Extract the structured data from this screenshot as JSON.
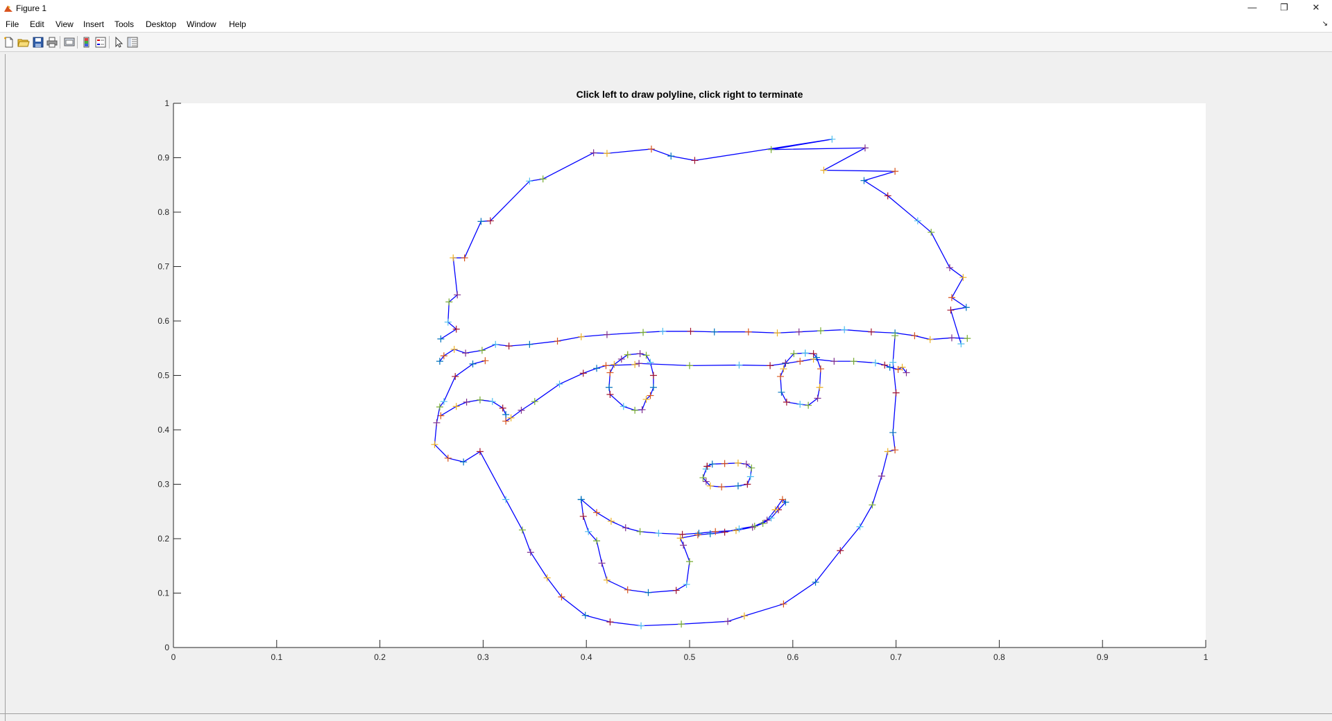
{
  "window": {
    "title": "Figure 1",
    "controls": {
      "minimize": "—",
      "maximize": "❐",
      "close": "✕"
    }
  },
  "menu": {
    "items": [
      {
        "label": "File"
      },
      {
        "label": "Edit"
      },
      {
        "label": "View"
      },
      {
        "label": "Insert"
      },
      {
        "label": "Tools"
      },
      {
        "label": "Desktop"
      },
      {
        "label": "Window"
      },
      {
        "label": "Help"
      }
    ],
    "dock_arrow": "↘"
  },
  "toolbar": {
    "buttons": [
      "new-figure-icon",
      "open-file-icon",
      "save-icon",
      "print-icon",
      "print-preview-icon",
      "colorbar-icon",
      "legend-icon",
      "pointer-icon",
      "property-editor-icon"
    ]
  },
  "colors": {
    "line": "#0000ff",
    "markers": [
      "#0072bd",
      "#d95319",
      "#edb120",
      "#7e2f8e",
      "#77ac30",
      "#4dbeee",
      "#a2142f"
    ],
    "axes_bg": "#ffffff",
    "figure_bg": "#f0f0f0"
  },
  "chart_data": {
    "type": "line",
    "title": "Click left to draw polyline, click right to terminate",
    "xlabel": "",
    "ylabel": "",
    "xlim": [
      0,
      1
    ],
    "ylim": [
      0,
      1
    ],
    "xticks": [
      0,
      0.1,
      0.2,
      0.3,
      0.4,
      0.5,
      0.6,
      0.7,
      0.8,
      0.9,
      1
    ],
    "yticks": [
      0,
      0.1,
      0.2,
      0.3,
      0.4,
      0.5,
      0.6,
      0.7,
      0.8,
      0.9,
      1
    ],
    "xtick_labels": [
      "0",
      "0.1",
      "0.2",
      "0.3",
      "0.4",
      "0.5",
      "0.6",
      "0.7",
      "0.8",
      "0.9",
      "1"
    ],
    "ytick_labels": [
      "0",
      "0.1",
      "0.2",
      "0.3",
      "0.4",
      "0.5",
      "0.6",
      "0.7",
      "0.8",
      "0.9",
      "1"
    ],
    "grid": false,
    "marker": "+",
    "series": [
      {
        "x": [
          0.258,
          0.262,
          0.272,
          0.283,
          0.299,
          0.312,
          0.325,
          0.345,
          0.372,
          0.395,
          0.42,
          0.455,
          0.474,
          0.501,
          0.524,
          0.557,
          0.585,
          0.606,
          0.627,
          0.65,
          0.676,
          0.699,
          0.718,
          0.733,
          0.754,
          0.769
        ],
        "y": [
          0.526,
          0.536,
          0.548,
          0.541,
          0.546,
          0.557,
          0.554,
          0.557,
          0.563,
          0.571,
          0.575,
          0.579,
          0.581,
          0.581,
          0.58,
          0.58,
          0.578,
          0.58,
          0.582,
          0.584,
          0.58,
          0.578,
          0.573,
          0.566,
          0.569,
          0.568
        ]
      },
      {
        "x": [
          0.763,
          0.753,
          0.768,
          0.754,
          0.765,
          0.752,
          0.734,
          0.721,
          0.692,
          0.669,
          0.699,
          0.63,
          0.67,
          0.579,
          0.638,
          0.505,
          0.482,
          0.463,
          0.42,
          0.407,
          0.358,
          0.345,
          0.307,
          0.298,
          0.282,
          0.271,
          0.275,
          0.267,
          0.266,
          0.274,
          0.259
        ],
        "y": [
          0.558,
          0.62,
          0.625,
          0.643,
          0.68,
          0.698,
          0.763,
          0.784,
          0.83,
          0.858,
          0.875,
          0.877,
          0.918,
          0.915,
          0.934,
          0.895,
          0.903,
          0.916,
          0.908,
          0.909,
          0.861,
          0.857,
          0.784,
          0.783,
          0.716,
          0.716,
          0.648,
          0.635,
          0.598,
          0.585,
          0.567
        ]
      },
      {
        "x": [
          0.259,
          0.274,
          0.284,
          0.297,
          0.309,
          0.319,
          0.322,
          0.322,
          0.327,
          0.337,
          0.35,
          0.374,
          0.397,
          0.41,
          0.419,
          0.447,
          0.451,
          0.5,
          0.548,
          0.578,
          0.593,
          0.607,
          0.62,
          0.64,
          0.659,
          0.68,
          0.689,
          0.694,
          0.702,
          0.706,
          0.71
        ],
        "y": [
          0.426,
          0.443,
          0.451,
          0.455,
          0.452,
          0.44,
          0.428,
          0.416,
          0.422,
          0.436,
          0.452,
          0.484,
          0.504,
          0.513,
          0.518,
          0.52,
          0.522,
          0.518,
          0.519,
          0.518,
          0.522,
          0.526,
          0.53,
          0.526,
          0.526,
          0.523,
          0.519,
          0.515,
          0.511,
          0.515,
          0.505
        ]
      },
      {
        "x": [
          0.699,
          0.697,
          0.7,
          0.697,
          0.699,
          0.692,
          0.686,
          0.677,
          0.665,
          0.646,
          0.622,
          0.591,
          0.553,
          0.537,
          0.492,
          0.453,
          0.423,
          0.399,
          0.376,
          0.362,
          0.346,
          0.338,
          0.322,
          0.297,
          0.281,
          0.266,
          0.253,
          0.255,
          0.258,
          0.262,
          0.273,
          0.29,
          0.302
        ],
        "y": [
          0.573,
          0.524,
          0.468,
          0.395,
          0.363,
          0.36,
          0.315,
          0.262,
          0.222,
          0.178,
          0.12,
          0.08,
          0.058,
          0.048,
          0.043,
          0.04,
          0.047,
          0.059,
          0.093,
          0.128,
          0.175,
          0.216,
          0.272,
          0.36,
          0.341,
          0.348,
          0.373,
          0.413,
          0.442,
          0.452,
          0.498,
          0.521,
          0.527
        ]
      },
      {
        "x": [
          0.44,
          0.452,
          0.458,
          0.462,
          0.465,
          0.465,
          0.462,
          0.458,
          0.454,
          0.447,
          0.436,
          0.423,
          0.422,
          0.423,
          0.427,
          0.434,
          0.44
        ],
        "y": [
          0.538,
          0.54,
          0.537,
          0.524,
          0.5,
          0.478,
          0.463,
          0.456,
          0.437,
          0.436,
          0.443,
          0.465,
          0.478,
          0.505,
          0.52,
          0.53,
          0.538
        ]
      },
      {
        "x": [
          0.612,
          0.62,
          0.623,
          0.627,
          0.626,
          0.624,
          0.615,
          0.607,
          0.594,
          0.589,
          0.588,
          0.591,
          0.593,
          0.601,
          0.612
        ],
        "y": [
          0.541,
          0.54,
          0.533,
          0.512,
          0.478,
          0.458,
          0.445,
          0.447,
          0.451,
          0.469,
          0.498,
          0.512,
          0.523,
          0.54,
          0.541
        ]
      },
      {
        "x": [
          0.517,
          0.522,
          0.534,
          0.547,
          0.555,
          0.56,
          0.559,
          0.556,
          0.547,
          0.531,
          0.52,
          0.516,
          0.513,
          0.516,
          0.517
        ],
        "y": [
          0.333,
          0.337,
          0.338,
          0.339,
          0.337,
          0.33,
          0.314,
          0.3,
          0.297,
          0.295,
          0.297,
          0.305,
          0.312,
          0.328,
          0.333
        ]
      },
      {
        "x": [
          0.395,
          0.41,
          0.424,
          0.438,
          0.452,
          0.47,
          0.493,
          0.509,
          0.525,
          0.545,
          0.561,
          0.571,
          0.579,
          0.586,
          0.593,
          0.59,
          0.583,
          0.575,
          0.563,
          0.548,
          0.534,
          0.52,
          0.508,
          0.491,
          0.494,
          0.5,
          0.497,
          0.487,
          0.46,
          0.44,
          0.42,
          0.415,
          0.41,
          0.402,
          0.397,
          0.395
        ],
        "y": [
          0.272,
          0.248,
          0.232,
          0.22,
          0.213,
          0.21,
          0.208,
          0.21,
          0.213,
          0.215,
          0.221,
          0.228,
          0.238,
          0.253,
          0.267,
          0.272,
          0.253,
          0.234,
          0.223,
          0.218,
          0.212,
          0.209,
          0.207,
          0.201,
          0.188,
          0.158,
          0.116,
          0.105,
          0.101,
          0.106,
          0.124,
          0.155,
          0.196,
          0.213,
          0.241,
          0.272
        ]
      }
    ]
  }
}
